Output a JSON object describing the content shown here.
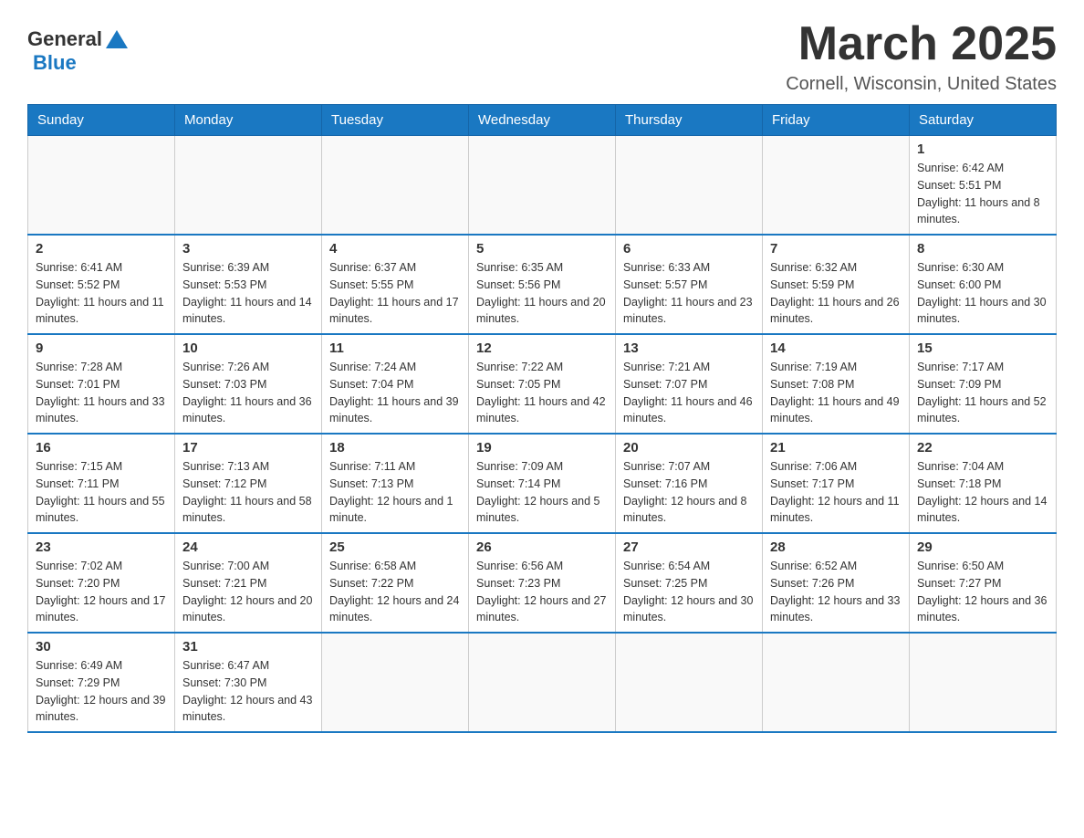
{
  "header": {
    "logo_general": "General",
    "logo_blue": "Blue",
    "month_title": "March 2025",
    "location": "Cornell, Wisconsin, United States"
  },
  "days_of_week": [
    "Sunday",
    "Monday",
    "Tuesday",
    "Wednesday",
    "Thursday",
    "Friday",
    "Saturday"
  ],
  "weeks": [
    [
      {
        "day": "",
        "sunrise": "",
        "sunset": "",
        "daylight": ""
      },
      {
        "day": "",
        "sunrise": "",
        "sunset": "",
        "daylight": ""
      },
      {
        "day": "",
        "sunrise": "",
        "sunset": "",
        "daylight": ""
      },
      {
        "day": "",
        "sunrise": "",
        "sunset": "",
        "daylight": ""
      },
      {
        "day": "",
        "sunrise": "",
        "sunset": "",
        "daylight": ""
      },
      {
        "day": "",
        "sunrise": "",
        "sunset": "",
        "daylight": ""
      },
      {
        "day": "1",
        "sunrise": "Sunrise: 6:42 AM",
        "sunset": "Sunset: 5:51 PM",
        "daylight": "Daylight: 11 hours and 8 minutes."
      }
    ],
    [
      {
        "day": "2",
        "sunrise": "Sunrise: 6:41 AM",
        "sunset": "Sunset: 5:52 PM",
        "daylight": "Daylight: 11 hours and 11 minutes."
      },
      {
        "day": "3",
        "sunrise": "Sunrise: 6:39 AM",
        "sunset": "Sunset: 5:53 PM",
        "daylight": "Daylight: 11 hours and 14 minutes."
      },
      {
        "day": "4",
        "sunrise": "Sunrise: 6:37 AM",
        "sunset": "Sunset: 5:55 PM",
        "daylight": "Daylight: 11 hours and 17 minutes."
      },
      {
        "day": "5",
        "sunrise": "Sunrise: 6:35 AM",
        "sunset": "Sunset: 5:56 PM",
        "daylight": "Daylight: 11 hours and 20 minutes."
      },
      {
        "day": "6",
        "sunrise": "Sunrise: 6:33 AM",
        "sunset": "Sunset: 5:57 PM",
        "daylight": "Daylight: 11 hours and 23 minutes."
      },
      {
        "day": "7",
        "sunrise": "Sunrise: 6:32 AM",
        "sunset": "Sunset: 5:59 PM",
        "daylight": "Daylight: 11 hours and 26 minutes."
      },
      {
        "day": "8",
        "sunrise": "Sunrise: 6:30 AM",
        "sunset": "Sunset: 6:00 PM",
        "daylight": "Daylight: 11 hours and 30 minutes."
      }
    ],
    [
      {
        "day": "9",
        "sunrise": "Sunrise: 7:28 AM",
        "sunset": "Sunset: 7:01 PM",
        "daylight": "Daylight: 11 hours and 33 minutes."
      },
      {
        "day": "10",
        "sunrise": "Sunrise: 7:26 AM",
        "sunset": "Sunset: 7:03 PM",
        "daylight": "Daylight: 11 hours and 36 minutes."
      },
      {
        "day": "11",
        "sunrise": "Sunrise: 7:24 AM",
        "sunset": "Sunset: 7:04 PM",
        "daylight": "Daylight: 11 hours and 39 minutes."
      },
      {
        "day": "12",
        "sunrise": "Sunrise: 7:22 AM",
        "sunset": "Sunset: 7:05 PM",
        "daylight": "Daylight: 11 hours and 42 minutes."
      },
      {
        "day": "13",
        "sunrise": "Sunrise: 7:21 AM",
        "sunset": "Sunset: 7:07 PM",
        "daylight": "Daylight: 11 hours and 46 minutes."
      },
      {
        "day": "14",
        "sunrise": "Sunrise: 7:19 AM",
        "sunset": "Sunset: 7:08 PM",
        "daylight": "Daylight: 11 hours and 49 minutes."
      },
      {
        "day": "15",
        "sunrise": "Sunrise: 7:17 AM",
        "sunset": "Sunset: 7:09 PM",
        "daylight": "Daylight: 11 hours and 52 minutes."
      }
    ],
    [
      {
        "day": "16",
        "sunrise": "Sunrise: 7:15 AM",
        "sunset": "Sunset: 7:11 PM",
        "daylight": "Daylight: 11 hours and 55 minutes."
      },
      {
        "day": "17",
        "sunrise": "Sunrise: 7:13 AM",
        "sunset": "Sunset: 7:12 PM",
        "daylight": "Daylight: 11 hours and 58 minutes."
      },
      {
        "day": "18",
        "sunrise": "Sunrise: 7:11 AM",
        "sunset": "Sunset: 7:13 PM",
        "daylight": "Daylight: 12 hours and 1 minute."
      },
      {
        "day": "19",
        "sunrise": "Sunrise: 7:09 AM",
        "sunset": "Sunset: 7:14 PM",
        "daylight": "Daylight: 12 hours and 5 minutes."
      },
      {
        "day": "20",
        "sunrise": "Sunrise: 7:07 AM",
        "sunset": "Sunset: 7:16 PM",
        "daylight": "Daylight: 12 hours and 8 minutes."
      },
      {
        "day": "21",
        "sunrise": "Sunrise: 7:06 AM",
        "sunset": "Sunset: 7:17 PM",
        "daylight": "Daylight: 12 hours and 11 minutes."
      },
      {
        "day": "22",
        "sunrise": "Sunrise: 7:04 AM",
        "sunset": "Sunset: 7:18 PM",
        "daylight": "Daylight: 12 hours and 14 minutes."
      }
    ],
    [
      {
        "day": "23",
        "sunrise": "Sunrise: 7:02 AM",
        "sunset": "Sunset: 7:20 PM",
        "daylight": "Daylight: 12 hours and 17 minutes."
      },
      {
        "day": "24",
        "sunrise": "Sunrise: 7:00 AM",
        "sunset": "Sunset: 7:21 PM",
        "daylight": "Daylight: 12 hours and 20 minutes."
      },
      {
        "day": "25",
        "sunrise": "Sunrise: 6:58 AM",
        "sunset": "Sunset: 7:22 PM",
        "daylight": "Daylight: 12 hours and 24 minutes."
      },
      {
        "day": "26",
        "sunrise": "Sunrise: 6:56 AM",
        "sunset": "Sunset: 7:23 PM",
        "daylight": "Daylight: 12 hours and 27 minutes."
      },
      {
        "day": "27",
        "sunrise": "Sunrise: 6:54 AM",
        "sunset": "Sunset: 7:25 PM",
        "daylight": "Daylight: 12 hours and 30 minutes."
      },
      {
        "day": "28",
        "sunrise": "Sunrise: 6:52 AM",
        "sunset": "Sunset: 7:26 PM",
        "daylight": "Daylight: 12 hours and 33 minutes."
      },
      {
        "day": "29",
        "sunrise": "Sunrise: 6:50 AM",
        "sunset": "Sunset: 7:27 PM",
        "daylight": "Daylight: 12 hours and 36 minutes."
      }
    ],
    [
      {
        "day": "30",
        "sunrise": "Sunrise: 6:49 AM",
        "sunset": "Sunset: 7:29 PM",
        "daylight": "Daylight: 12 hours and 39 minutes."
      },
      {
        "day": "31",
        "sunrise": "Sunrise: 6:47 AM",
        "sunset": "Sunset: 7:30 PM",
        "daylight": "Daylight: 12 hours and 43 minutes."
      },
      {
        "day": "",
        "sunrise": "",
        "sunset": "",
        "daylight": ""
      },
      {
        "day": "",
        "sunrise": "",
        "sunset": "",
        "daylight": ""
      },
      {
        "day": "",
        "sunrise": "",
        "sunset": "",
        "daylight": ""
      },
      {
        "day": "",
        "sunrise": "",
        "sunset": "",
        "daylight": ""
      },
      {
        "day": "",
        "sunrise": "",
        "sunset": "",
        "daylight": ""
      }
    ]
  ]
}
